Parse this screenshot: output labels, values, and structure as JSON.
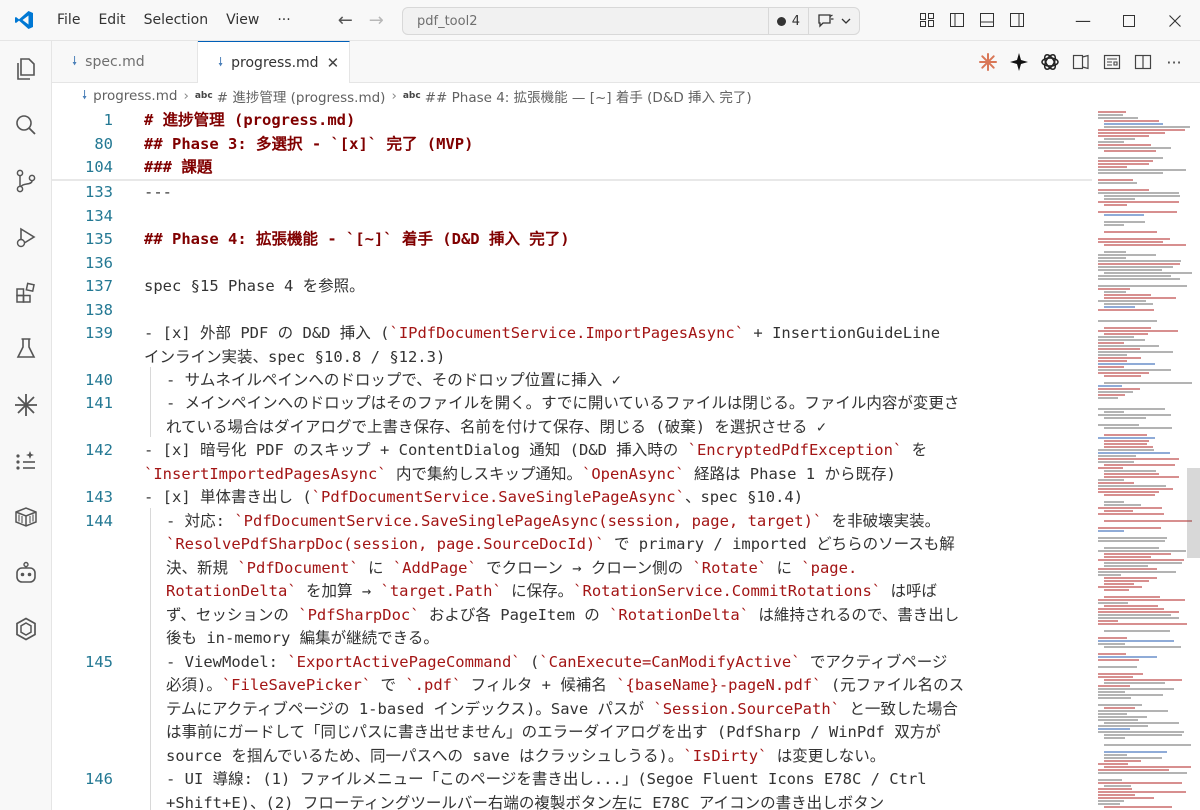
{
  "menu": [
    "File",
    "Edit",
    "Selection",
    "View",
    "···"
  ],
  "command_center": {
    "text": "pdf_tool2",
    "count": "4"
  },
  "tabs": [
    {
      "label": "spec.md",
      "active": false
    },
    {
      "label": "progress.md",
      "active": true,
      "close": "✕"
    }
  ],
  "breadcrumb": {
    "file": "progress.md",
    "sym1": "# 進捗管理 (progress.md)",
    "sym2": "## Phase 4: 拡張機能 — [~] 着手 (D&D 挿入 完了)",
    "abc": "abc"
  },
  "colors": {
    "accent": "#005fb8",
    "line_number": "#237893",
    "heading": "#800000",
    "backtick": "#a31515"
  },
  "lines": [
    {
      "n": "1",
      "seg": [
        [
          "h",
          "# 進捗管理 (progress.md)"
        ]
      ]
    },
    {
      "n": "80",
      "seg": [
        [
          "h",
          "## Phase 3: 多選択 - `[x]` 完了 (MVP)"
        ]
      ]
    },
    {
      "n": "104",
      "seg": [
        [
          "h",
          "### 課題"
        ]
      ]
    },
    {
      "n": "133",
      "seg": [
        [
          "t",
          "---"
        ]
      ]
    },
    {
      "n": "134",
      "seg": []
    },
    {
      "n": "135",
      "seg": [
        [
          "h",
          "## Phase 4: 拡張機能 - `[~]` 着手 (D&D 挿入 完了)"
        ]
      ]
    },
    {
      "n": "136",
      "seg": []
    },
    {
      "n": "137",
      "seg": [
        [
          "t",
          "spec §15 Phase 4 を参照。"
        ]
      ]
    },
    {
      "n": "138",
      "seg": []
    },
    {
      "n": "139",
      "seg": [
        [
          "t",
          "- [x] 外部 PDF の D&D 挿入 ("
        ],
        [
          "b",
          "`IPdfDocumentService.ImportPagesAsync`"
        ],
        [
          "t",
          " + InsertionGuideLine"
        ]
      ]
    },
    {
      "n": "",
      "seg": [
        [
          "t",
          "インライン実装、spec §10.8 / §12.3)"
        ]
      ]
    },
    {
      "n": "140",
      "in": 1,
      "seg": [
        [
          "t",
          "- サムネイルペインへのドロップで、そのドロップ位置に挿入 ✓"
        ]
      ]
    },
    {
      "n": "141",
      "in": 1,
      "seg": [
        [
          "t",
          "- メインペインへのドロップはそのファイルを開く。すでに開いているファイルは閉じる。ファイル内容が変更さ"
        ]
      ]
    },
    {
      "n": "",
      "in": 1,
      "seg": [
        [
          "t",
          "れている場合はダイアログで上書き保存、名前を付けて保存、閉じる (破棄) を選択させる ✓"
        ]
      ]
    },
    {
      "n": "142",
      "seg": [
        [
          "t",
          "- [x] 暗号化 PDF のスキップ + ContentDialog 通知 (D&D 挿入時の "
        ],
        [
          "b",
          "`EncryptedPdfException`"
        ],
        [
          "t",
          " を"
        ]
      ]
    },
    {
      "n": "",
      "seg": [
        [
          "b",
          "`InsertImportedPagesAsync`"
        ],
        [
          "t",
          " 内で集約しスキップ通知。"
        ],
        [
          "b",
          "`OpenAsync`"
        ],
        [
          "t",
          " 経路は Phase 1 から既存)"
        ]
      ]
    },
    {
      "n": "143",
      "seg": [
        [
          "t",
          "- [x] 単体書き出し ("
        ],
        [
          "b",
          "`PdfDocumentService.SaveSinglePageAsync`"
        ],
        [
          "t",
          "、spec §10.4)"
        ]
      ]
    },
    {
      "n": "144",
      "in": 1,
      "seg": [
        [
          "t",
          "- 対応: "
        ],
        [
          "b",
          "`PdfDocumentService.SaveSinglePageAsync(session, page, target)`"
        ],
        [
          "t",
          " を非破壊実装。"
        ]
      ]
    },
    {
      "n": "",
      "in": 1,
      "seg": [
        [
          "b",
          "`ResolvePdfSharpDoc(session, page.SourceDocId)`"
        ],
        [
          "t",
          " で primary / imported どちらのソースも解"
        ]
      ]
    },
    {
      "n": "",
      "in": 1,
      "seg": [
        [
          "t",
          "決、新規 "
        ],
        [
          "b",
          "`PdfDocument`"
        ],
        [
          "t",
          " に "
        ],
        [
          "b",
          "`AddPage`"
        ],
        [
          "t",
          " でクローン → クローン側の "
        ],
        [
          "b",
          "`Rotate`"
        ],
        [
          "t",
          " に "
        ],
        [
          "b",
          "`page."
        ]
      ]
    },
    {
      "n": "",
      "in": 1,
      "seg": [
        [
          "b",
          "RotationDelta`"
        ],
        [
          "t",
          " を加算 → "
        ],
        [
          "b",
          "`target.Path`"
        ],
        [
          "t",
          " に保存。"
        ],
        [
          "b",
          "`RotationService.CommitRotations`"
        ],
        [
          "t",
          " は呼ば"
        ]
      ]
    },
    {
      "n": "",
      "in": 1,
      "seg": [
        [
          "t",
          "ず、セッションの "
        ],
        [
          "b",
          "`PdfSharpDoc`"
        ],
        [
          "t",
          " および各 PageItem の "
        ],
        [
          "b",
          "`RotationDelta`"
        ],
        [
          "t",
          " は維持されるので、書き出し"
        ]
      ]
    },
    {
      "n": "",
      "in": 1,
      "seg": [
        [
          "t",
          "後も in-memory 編集が継続できる。"
        ]
      ]
    },
    {
      "n": "145",
      "in": 1,
      "seg": [
        [
          "t",
          "- ViewModel: "
        ],
        [
          "b",
          "`ExportActivePageCommand`"
        ],
        [
          "t",
          " ("
        ],
        [
          "b",
          "`CanExecute=CanModifyActive`"
        ],
        [
          "t",
          " でアクティブページ"
        ]
      ]
    },
    {
      "n": "",
      "in": 1,
      "seg": [
        [
          "t",
          "必須)。"
        ],
        [
          "b",
          "`FileSavePicker`"
        ],
        [
          "t",
          " で "
        ],
        [
          "b",
          "`.pdf`"
        ],
        [
          "t",
          " フィルタ + 候補名 "
        ],
        [
          "b",
          "`{baseName}-pageN.pdf`"
        ],
        [
          "t",
          " (元ファイル名のス"
        ]
      ]
    },
    {
      "n": "",
      "in": 1,
      "seg": [
        [
          "t",
          "テムにアクティブページの 1-based インデックス)。Save パスが "
        ],
        [
          "b",
          "`Session.SourcePath`"
        ],
        [
          "t",
          " と一致した場合"
        ]
      ]
    },
    {
      "n": "",
      "in": 1,
      "seg": [
        [
          "t",
          "は事前にガードして「同じパスに書き出せません」のエラーダイアログを出す (PdfSharp / WinPdf 双方が"
        ]
      ]
    },
    {
      "n": "",
      "in": 1,
      "seg": [
        [
          "t",
          "source を掴んでいるため、同一パスへの save はクラッシュしうる)。"
        ],
        [
          "b",
          "`IsDirty`"
        ],
        [
          "t",
          " は変更しない。"
        ]
      ]
    },
    {
      "n": "146",
      "in": 1,
      "seg": [
        [
          "t",
          "- UI 導線: (1) ファイルメニュー「このページを書き出し...」(Segoe Fluent Icons E78C / Ctrl"
        ]
      ]
    },
    {
      "n": "",
      "in": 1,
      "seg": [
        [
          "t",
          "+Shift+E)、(2) フローティングツールバー右端の複製ボタン左に E78C アイコンの書き出しボタン"
        ]
      ]
    }
  ]
}
